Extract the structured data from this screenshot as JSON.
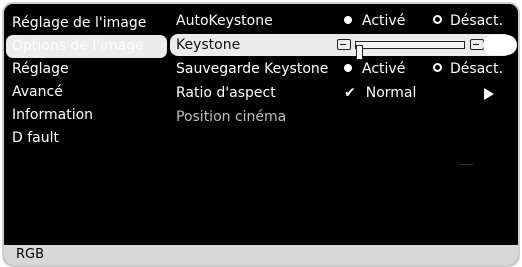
{
  "left_menu": {
    "items": [
      {
        "label": "Réglage de l'image"
      },
      {
        "label": "Options de l'image"
      },
      {
        "label": "Réglage"
      },
      {
        "label": "Avancé"
      },
      {
        "label": "Information"
      },
      {
        "label": "D fault"
      }
    ],
    "selected_index": 1
  },
  "settings": {
    "auto_keystone": {
      "label": "AutoKeystone",
      "option_on": "Activé",
      "option_off": "Désact.",
      "value": "Activé"
    },
    "keystone": {
      "label": "Keystone",
      "slider_level": 0.0
    },
    "sauvegarde_keystone": {
      "label": "Sauvegarde Keystone",
      "option_on": "Activé",
      "option_off": "Désact.",
      "value": "Activé"
    },
    "ratio": {
      "label": "Ratio d'aspect",
      "value": "Normal"
    },
    "position_cinema": {
      "label": "Position cinéma"
    }
  },
  "status_bar": {
    "source": "RGB"
  },
  "colors": {
    "background": "#000000",
    "highlight": "#ececec",
    "status_bar": "#d8d8d8",
    "text": "#ffffff"
  }
}
